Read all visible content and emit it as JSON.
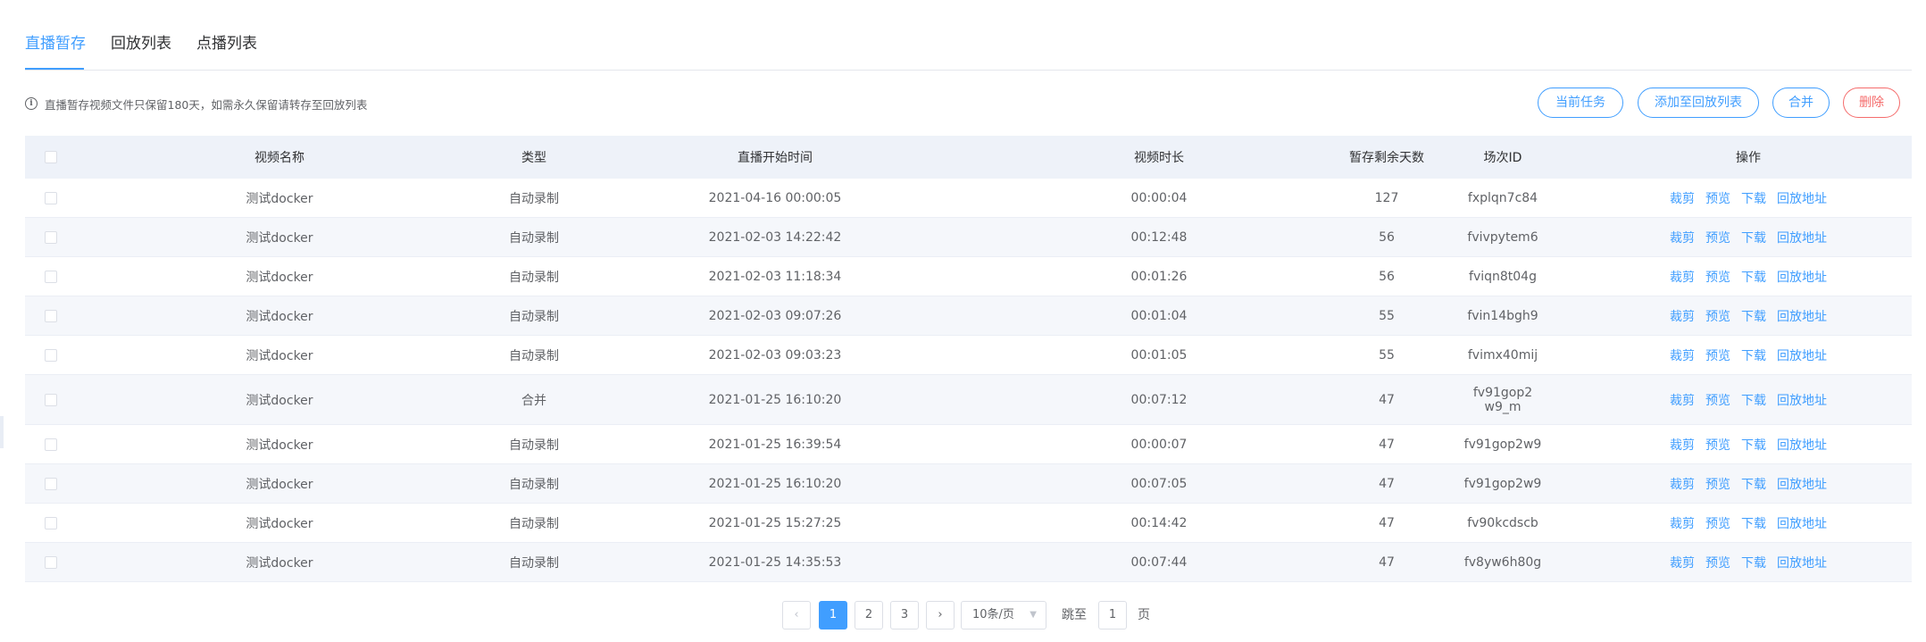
{
  "tabs": [
    {
      "label": "直播暂存"
    },
    {
      "label": "回放列表"
    },
    {
      "label": "点播列表"
    }
  ],
  "notice": "直播暂存视频文件只保留180天，如需永久保留请转存至回放列表",
  "actions": {
    "current_task": "当前任务",
    "add_to_replay": "添加至回放列表",
    "merge": "合并",
    "delete": "删除"
  },
  "table": {
    "headers": {
      "name": "视频名称",
      "type": "类型",
      "start_time": "直播开始时间",
      "duration": "视频时长",
      "days_left": "暂存剩余天数",
      "session_id": "场次ID",
      "ops": "操作"
    },
    "op_labels": {
      "crop": "裁剪",
      "preview": "预览",
      "download": "下载",
      "replay_url": "回放地址"
    },
    "rows": [
      {
        "name": "测试docker",
        "type": "自动录制",
        "start_time": "2021-04-16 00:00:05",
        "duration": "00:00:04",
        "days_left": "127",
        "session_id": "fxplqn7c84"
      },
      {
        "name": "测试docker",
        "type": "自动录制",
        "start_time": "2021-02-03 14:22:42",
        "duration": "00:12:48",
        "days_left": "56",
        "session_id": "fvivpytem6"
      },
      {
        "name": "测试docker",
        "type": "自动录制",
        "start_time": "2021-02-03 11:18:34",
        "duration": "00:01:26",
        "days_left": "56",
        "session_id": "fviqn8t04g"
      },
      {
        "name": "测试docker",
        "type": "自动录制",
        "start_time": "2021-02-03 09:07:26",
        "duration": "00:01:04",
        "days_left": "55",
        "session_id": "fvin14bgh9"
      },
      {
        "name": "测试docker",
        "type": "自动录制",
        "start_time": "2021-02-03 09:03:23",
        "duration": "00:01:05",
        "days_left": "55",
        "session_id": "fvimx40mij"
      },
      {
        "name": "测试docker",
        "type": "合并",
        "start_time": "2021-01-25 16:10:20",
        "duration": "00:07:12",
        "days_left": "47",
        "session_id": "fv91gop2w9_m"
      },
      {
        "name": "测试docker",
        "type": "自动录制",
        "start_time": "2021-01-25 16:39:54",
        "duration": "00:00:07",
        "days_left": "47",
        "session_id": "fv91gop2w9"
      },
      {
        "name": "测试docker",
        "type": "自动录制",
        "start_time": "2021-01-25 16:10:20",
        "duration": "00:07:05",
        "days_left": "47",
        "session_id": "fv91gop2w9"
      },
      {
        "name": "测试docker",
        "type": "自动录制",
        "start_time": "2021-01-25 15:27:25",
        "duration": "00:14:42",
        "days_left": "47",
        "session_id": "fv90kcdscb"
      },
      {
        "name": "测试docker",
        "type": "自动录制",
        "start_time": "2021-01-25 14:35:53",
        "duration": "00:07:44",
        "days_left": "47",
        "session_id": "fv8yw6h80g"
      }
    ]
  },
  "pagination": {
    "prev": "‹",
    "next": "›",
    "pages": [
      "1",
      "2",
      "3"
    ],
    "current": "1",
    "page_size": "10条/页",
    "jump_label": "跳至",
    "jump_value": "1",
    "page_unit": "页"
  },
  "colors": {
    "accent": "#409eff",
    "danger": "#f56c6c",
    "header_bg": "#eef2f9",
    "stripe_bg": "#f5f7fb"
  }
}
